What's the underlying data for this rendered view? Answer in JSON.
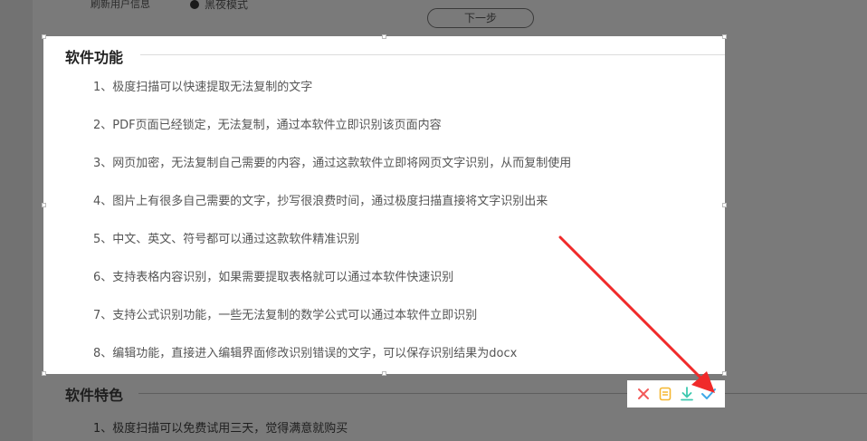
{
  "background": {
    "top_left_text": "刷新用户信息",
    "toggle_label": "黑夜模式",
    "next_button_label": "下一步",
    "section_title": "软件特色",
    "first_item": "1、极度扫描可以免费试用三天，觉得满意就购买"
  },
  "selection": {
    "title": "软件功能",
    "items": [
      "1、极度扫描可以快速提取无法复制的文字",
      "2、PDF页面已经锁定，无法复制，通过本软件立即识别该页面内容",
      "3、网页加密，无法复制自己需要的内容，通过这款软件立即将网页文字识别，从而复制使用",
      "4、图片上有很多自己需要的文字，抄写很浪费时间，通过极度扫描直接将文字识别出来",
      "5、中文、英文、符号都可以通过这款软件精准识别",
      "6、支持表格内容识别，如果需要提取表格就可以通过本软件快速识别",
      "7、支持公式识别功能，一些无法复制的数学公式可以通过本软件立即识别",
      "8、编辑功能，直接进入编辑界面修改识别错误的文字，可以保存识别结果为docx"
    ]
  },
  "toolbar": {
    "tools": [
      {
        "icon": "close-icon",
        "color": "#f25a5a"
      },
      {
        "icon": "notepad-icon",
        "color": "#f5b731"
      },
      {
        "icon": "download-icon",
        "color": "#3ec9b0"
      },
      {
        "icon": "check-icon",
        "color": "#3fa9e8"
      }
    ]
  },
  "annotation": {
    "arrow_color": "#f02a2a"
  }
}
